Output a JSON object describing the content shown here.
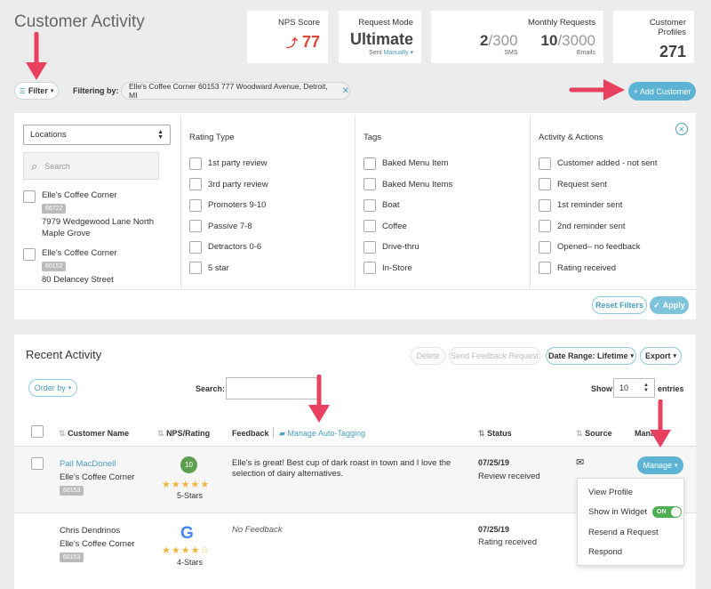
{
  "page": {
    "title": "Customer Activity"
  },
  "stats": {
    "nps": {
      "label": "NPS Score",
      "value": "77"
    },
    "mode": {
      "label": "Request Mode",
      "value": "Ultimate",
      "sub_prefix": "Sent",
      "sub_link": "Manually"
    },
    "monthly": {
      "label": "Monthly Requests",
      "sms_used": "2",
      "sms_total": "/300",
      "sms_label": "SMS",
      "email_used": "10",
      "email_total": "/3000",
      "email_label": "Emails"
    },
    "profiles": {
      "label": "Customer Profiles",
      "value": "271"
    }
  },
  "filter_bar": {
    "filter_label": "Filter",
    "filtering_by_label": "Filtering by:",
    "chip_text": "Elle's Coffee Corner 60153 777 Woodward Avenue, Detroit, MI",
    "add_customer_label": "+ Add Customer"
  },
  "filters": {
    "locations_select": "Locations",
    "search_placeholder": "Search",
    "locations": [
      {
        "name": "Elle's Coffee Corner",
        "code": "66722",
        "address1": "7979 Wedgewood Lane North",
        "address2": "Maple Grove"
      },
      {
        "name": "Elle's Coffee Corner",
        "code": "60152",
        "address1": "80 Delancey Street",
        "address2": ""
      }
    ],
    "rating_type": {
      "title": "Rating Type",
      "options": [
        "1st party review",
        "3rd party review",
        "Promoters 9-10",
        "Passive 7-8",
        "Detractors 0-6",
        "5 star"
      ]
    },
    "tags": {
      "title": "Tags",
      "options": [
        "Baked Menu Item",
        "Baked Menu Items",
        "Boat",
        "Coffee",
        "Drive-thru",
        "In-Store"
      ]
    },
    "activity": {
      "title": "Activity & Actions",
      "options": [
        "Customer added - not sent",
        "Request sent",
        "1st reminder sent",
        "2nd reminder sent",
        "Opened– no feedback",
        "Rating received"
      ]
    },
    "reset_label": "Reset Filters",
    "apply_label": "Apply"
  },
  "recent": {
    "title": "Recent Activity",
    "delete_label": "Delete",
    "send_feedback_label": "Send Feedback Request",
    "date_range_label": "Date Range: Lifetime",
    "export_label": "Export",
    "order_by_label": "Order by",
    "search_label": "Search:",
    "show_label": "Show",
    "show_value": "10",
    "entries_label": "entries",
    "columns": {
      "name": "Customer Name",
      "nps": "NPS/Rating",
      "feedback": "Feedback",
      "auto_tag": "Manage Auto-Tagging",
      "status": "Status",
      "source": "Source",
      "manage": "Manage"
    },
    "rows": [
      {
        "name": "Pail MacDonell",
        "location": "Elle's Coffee Corner",
        "code": "60153",
        "score": "10",
        "stars": "★★★★★",
        "stars_label": "5-Stars",
        "feedback": "Elle's is great! Best cup of dark roast in town and I love the selection of dairy alternatives.",
        "date": "07/25/19",
        "status": "Review received",
        "manage_label": "Manage"
      },
      {
        "name": "Chris Dendrinos",
        "location": "Elle's Coffee Corner",
        "code": "60153",
        "stars": "★★★★☆",
        "stars_label": "4-Stars",
        "feedback": "No Feedback",
        "date": "07/25/19",
        "status": "Rating received"
      }
    ],
    "menu": {
      "view_profile": "View Profile",
      "show_in_widget": "Show in Widget",
      "toggle": "ON",
      "resend": "Resend a Request",
      "respond": "Respond"
    }
  },
  "colors": {
    "accent": "#4a9fbf",
    "nps": "#d9463a",
    "arrow": "#e8405f",
    "score_badge": "#5d9e4f",
    "toggle": "#4caf50"
  }
}
